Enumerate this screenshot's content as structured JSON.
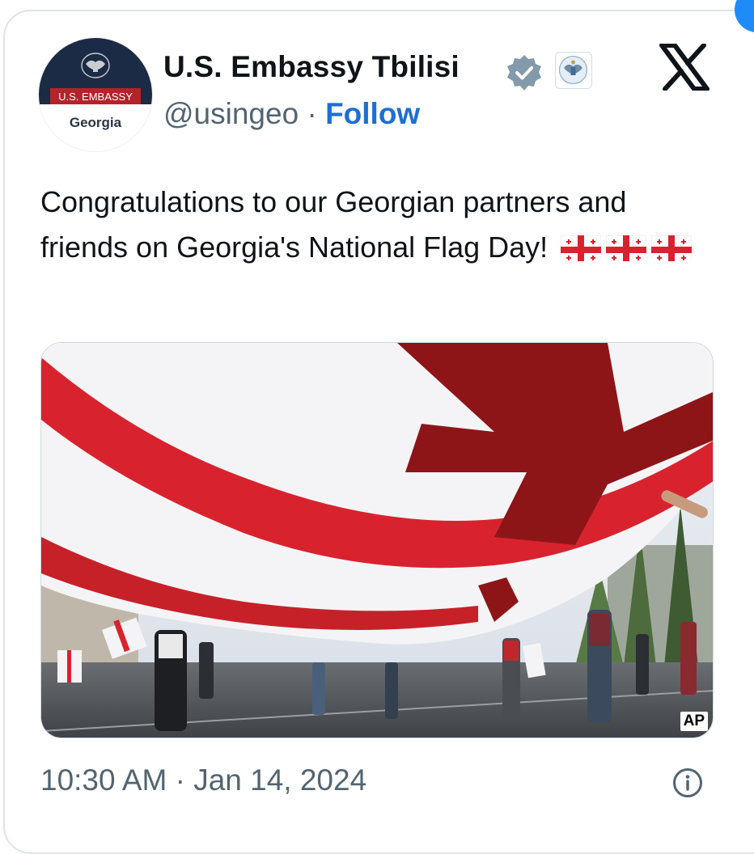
{
  "account": {
    "name": "U.S. Embassy Tbilisi",
    "handle": "@usingeo",
    "separator": "·",
    "follow_label": "Follow",
    "avatar": {
      "banner_text": "U.S. EMBASSY",
      "location_text": "Georgia"
    }
  },
  "tweet": {
    "text": "Congratulations to our Georgian partners and friends on Georgia's National Flag Day!",
    "emoji": [
      "georgian-flag-emoji",
      "georgian-flag-emoji",
      "georgian-flag-emoji"
    ],
    "photo": {
      "credit": "AP"
    }
  },
  "meta": {
    "timestamp": "10:30 AM · Jan 14, 2024"
  },
  "icons": {
    "verified": "verified-badge-icon",
    "affiliate": "government-seal-icon",
    "platform": "x-logo-icon",
    "info": "info-icon"
  },
  "colors": {
    "text_primary": "#0f1419",
    "text_secondary": "#536471",
    "follow_link": "#1d6fd1",
    "verified_badge": "#829aab",
    "flag_red": "#d8232f",
    "flag_dark_red": "#8d1518",
    "avatar_navy": "#1c2b45",
    "avatar_banner_red": "#b3232a"
  }
}
